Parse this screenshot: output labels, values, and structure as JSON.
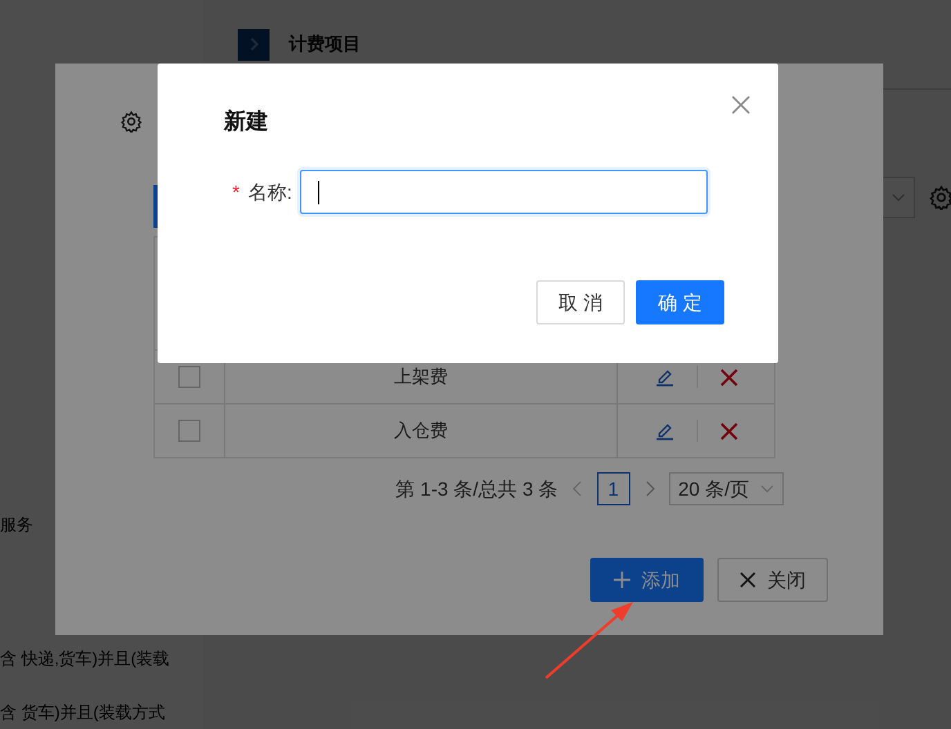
{
  "background_page": {
    "header_title": "计费项目",
    "sidebar_texts": [
      "服务",
      "含 快递,货车)并且(装载",
      "含 货车)并且(装载方式"
    ]
  },
  "billing_dialog": {
    "rows": [
      {
        "name": "上架费",
        "checked": false
      },
      {
        "name": "入仓费",
        "checked": false
      }
    ],
    "pagination": {
      "summary": "第 1-3 条/总共 3 条",
      "pages": [
        {
          "label": "1",
          "selected": true
        }
      ],
      "page_size": "20 条/页"
    },
    "buttons": [
      {
        "label": "添加",
        "kind": "add"
      },
      {
        "label": "关闭",
        "kind": "close"
      }
    ]
  },
  "new_dialog": {
    "title": "新建",
    "field": {
      "required_mark": "*",
      "label": "名称:",
      "focused": true
    },
    "buttons": [
      {
        "label": "取 消",
        "kind": "default"
      },
      {
        "label": "确 定",
        "kind": "primary"
      }
    ]
  }
}
